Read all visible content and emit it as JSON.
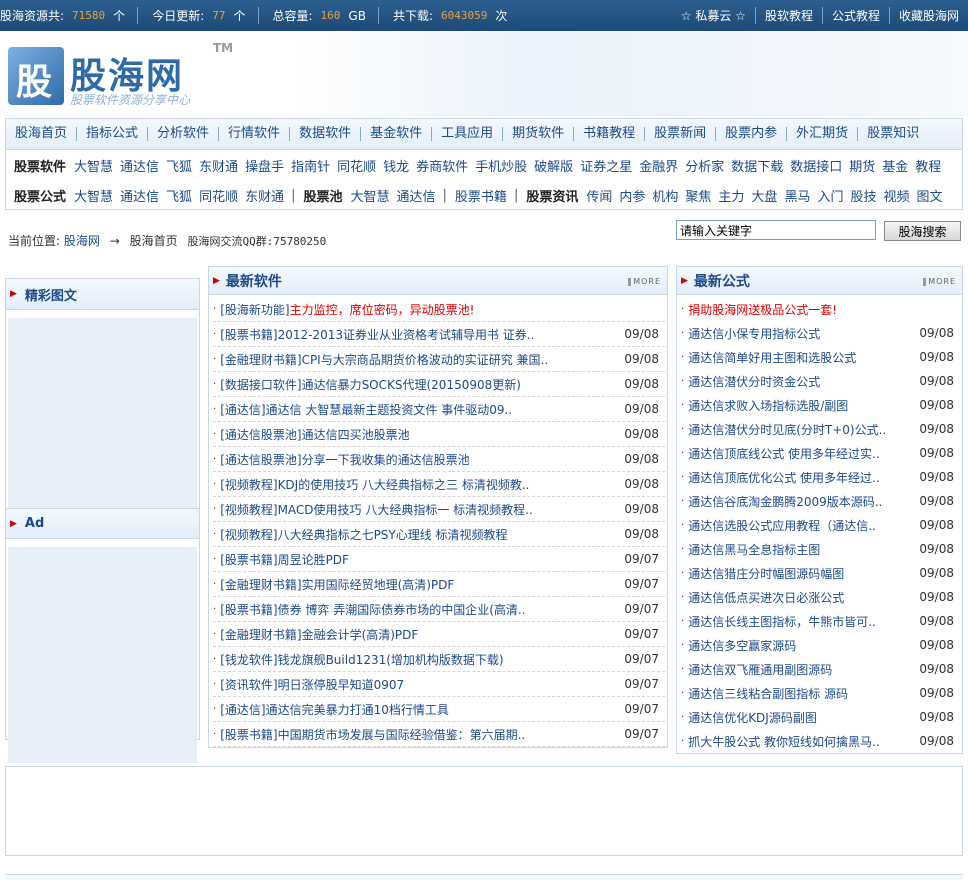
{
  "topbar": {
    "stats": [
      {
        "label": "股海资源共:",
        "value": "71580",
        "unit": "个"
      },
      {
        "label": "今日更新:",
        "value": "77",
        "unit": "个"
      },
      {
        "label": "总容量:",
        "value": "160",
        "unit": "GB"
      },
      {
        "label": "共下载:",
        "value": "6043059",
        "unit": "次"
      }
    ],
    "links": [
      "☆ 私募云 ☆",
      "股软教程",
      "公式教程",
      "收藏股海网"
    ]
  },
  "logo": {
    "title": "股海网",
    "tm": "TM",
    "subtitle": "股票软件资源分享中心"
  },
  "mainnav": [
    "股海首页",
    "指标公式",
    "分析软件",
    "行情软件",
    "数据软件",
    "基金软件",
    "工具应用",
    "期货软件",
    "书籍教程",
    "股票新闻",
    "股票内参",
    "外汇期货",
    "股票知识"
  ],
  "subnav1": {
    "category": "股票软件",
    "links": [
      "大智慧",
      "通达信",
      "飞狐",
      "东财通",
      "操盘手",
      "指南针",
      "同花顺",
      "钱龙",
      "券商软件",
      "手机炒股",
      "破解版",
      "证券之星",
      "金融界",
      "分析家",
      "数据下载",
      "数据接口",
      "期货",
      "基金",
      "教程"
    ]
  },
  "subnav2": {
    "groups": [
      {
        "category": "股票公式",
        "links": [
          "大智慧",
          "通达信",
          "飞狐",
          "同花顺",
          "东财通"
        ]
      },
      {
        "category": "股票池",
        "links": [
          "大智慧",
          "通达信"
        ]
      },
      {
        "category": "",
        "links": [
          "股票书籍"
        ]
      },
      {
        "category": "股票资讯",
        "links": [
          "传闻",
          "内参",
          "机构",
          "聚焦",
          "主力",
          "大盘",
          "黑马",
          "入门",
          "股技",
          "视频",
          "图文"
        ]
      }
    ],
    "separator": "|"
  },
  "location": {
    "prefix": "当前位置:",
    "site": "股海网",
    "arrow": "→",
    "page": "股海首页",
    "qq": "股海网交流QQ群:75780250"
  },
  "search": {
    "value": "请输入关键字",
    "button": "股海搜索"
  },
  "left": {
    "panel1": "精彩图文",
    "panel2": "Ad"
  },
  "middle": {
    "title": "最新软件",
    "more": "MORE",
    "items": [
      {
        "cat": "[股海新功能]",
        "text": "主力监控，席位密码，异动股票池!",
        "date": "",
        "red": true
      },
      {
        "cat": "[股票书籍]",
        "text": "2012-2013证券业从业资格考试辅导用书 证券..",
        "date": "09/08"
      },
      {
        "cat": "[金融理财书籍]",
        "text": "CPI与大宗商品期货价格波动的实证研究 兼国..",
        "date": "09/08"
      },
      {
        "cat": "[数据接口软件]",
        "text": "通达信暴力SOCKS代理(20150908更新)",
        "date": "09/08"
      },
      {
        "cat": "[通达信]",
        "text": "通达信 大智慧最新主题投资文件 事件驱动09..",
        "date": "09/08"
      },
      {
        "cat": "[通达信股票池]",
        "text": "通达信四买池股票池",
        "date": "09/08"
      },
      {
        "cat": "[通达信股票池]",
        "text": "分享一下我收集的通达信股票池",
        "date": "09/08"
      },
      {
        "cat": "[视频教程]",
        "text": "KDJ的使用技巧 八大经典指标之三 标清视频教..",
        "date": "09/08"
      },
      {
        "cat": "[视频教程]",
        "text": "MACD使用技巧 八大经典指标一 标清视频教程..",
        "date": "09/08"
      },
      {
        "cat": "[视频教程]",
        "text": "八大经典指标之七PSY心理线 标清视频教程",
        "date": "09/08"
      },
      {
        "cat": "[股票书籍]",
        "text": "周昱论胜PDF",
        "date": "09/07"
      },
      {
        "cat": "[金融理财书籍]",
        "text": "实用国际经贸地理(高清)PDF",
        "date": "09/07"
      },
      {
        "cat": "[股票书籍]",
        "text": "债券 博弈 弄潮国际债券市场的中国企业(高清..",
        "date": "09/07"
      },
      {
        "cat": "[金融理财书籍]",
        "text": "金融会计学(高清)PDF",
        "date": "09/07"
      },
      {
        "cat": "[钱龙软件]",
        "text": "钱龙旗舰Build1231(增加机构版数据下载)",
        "date": "09/07"
      },
      {
        "cat": "[资讯软件]",
        "text": "明日涨停股早知道0907",
        "date": "09/07"
      },
      {
        "cat": "[通达信]",
        "text": "通达信完美暴力打通10档行情工具",
        "date": "09/07"
      },
      {
        "cat": "[股票书籍]",
        "text": "中国期货市场发展与国际经验借鉴：第六届期..",
        "date": "09/07"
      }
    ]
  },
  "right": {
    "title": "最新公式",
    "more": "MORE",
    "items": [
      {
        "text": "捐助股海网送极品公式一套!",
        "date": "",
        "red": true
      },
      {
        "text": "通达信小保专用指标公式",
        "date": "09/08"
      },
      {
        "text": "通达信简单好用主图和选股公式",
        "date": "09/08"
      },
      {
        "text": "通达信潜伏分时资金公式",
        "date": "09/08"
      },
      {
        "text": "通达信求败入场指标选股/副图",
        "date": "09/08"
      },
      {
        "text": "通达信潜伏分时见底(分时T+0)公式..",
        "date": "09/08"
      },
      {
        "text": "通达信顶底线公式 使用多年经过实..",
        "date": "09/08"
      },
      {
        "text": "通达信顶底优化公式 使用多年经过..",
        "date": "09/08"
      },
      {
        "text": "通达信谷底淘金鹏腾2009版本源码..",
        "date": "09/08"
      },
      {
        "text": "通达信选股公式应用教程（通达信..",
        "date": "09/08"
      },
      {
        "text": "通达信黑马全息指标主图",
        "date": "09/08"
      },
      {
        "text": "通达信猎庄分时幅图源码幅图",
        "date": "09/08"
      },
      {
        "text": "通达信低点买进次日必涨公式",
        "date": "09/08"
      },
      {
        "text": "通达信长线主图指标，牛熊市皆可..",
        "date": "09/08"
      },
      {
        "text": "通达信多空赢家源码",
        "date": "09/08"
      },
      {
        "text": "通达信双飞雁通用副图源码",
        "date": "09/08"
      },
      {
        "text": "通达信三线粘合副图指标 源码",
        "date": "09/08"
      },
      {
        "text": "通达信优化KDJ源码副图",
        "date": "09/08"
      },
      {
        "text": "抓大牛股公式 教你短线如何擒黑马..",
        "date": "09/08"
      }
    ]
  }
}
